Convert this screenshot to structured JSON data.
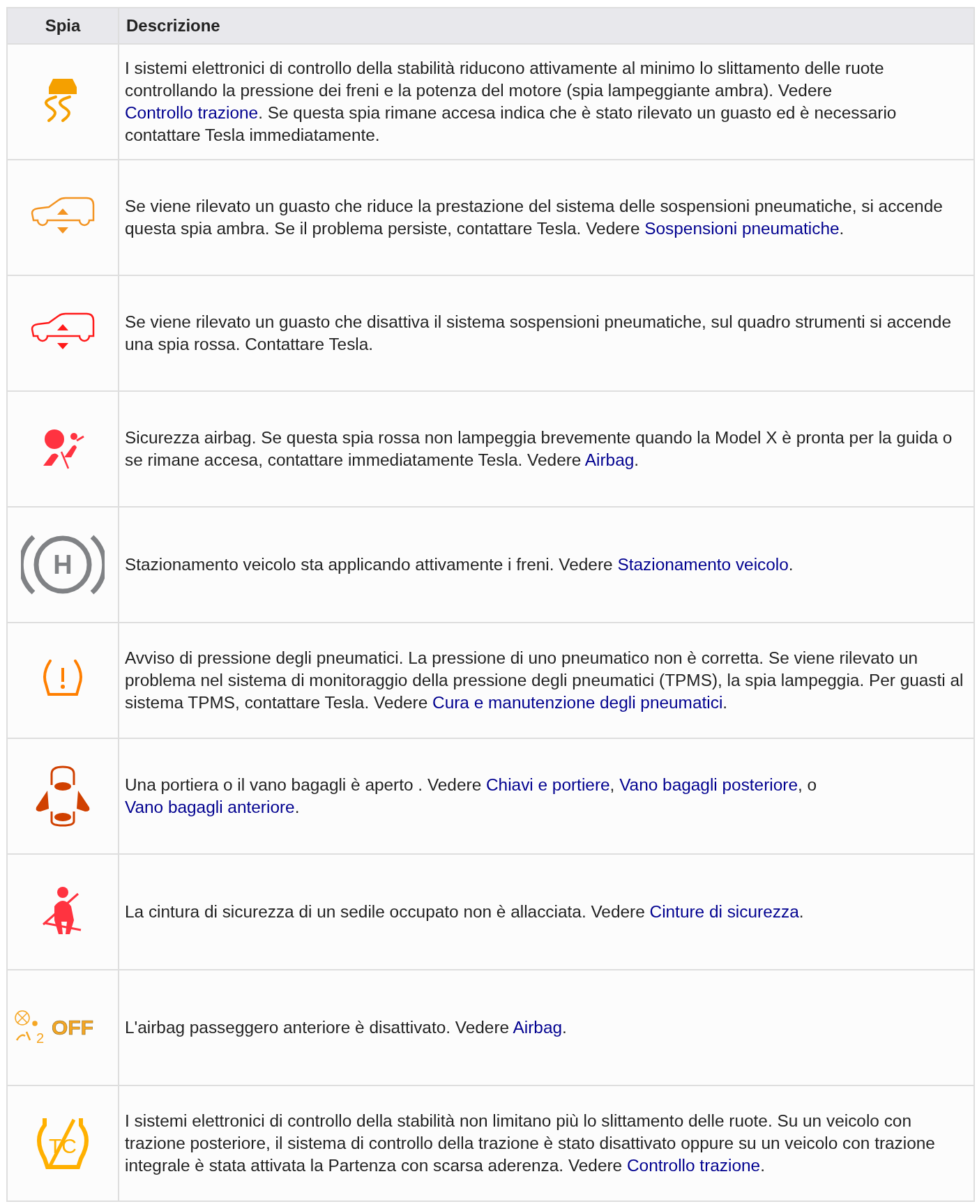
{
  "table": {
    "columns": [
      "Spia",
      "Descrizione"
    ],
    "rows": [
      {
        "description": [
          {
            "text": "I sistemi elettronici di controllo della stabilità riducono attivamente al minimo lo slittamento delle ruote controllando la pressione dei freni e la potenza del motore (spia lampeggiante ambra). Vedere "
          },
          {
            "text": "Controllo trazione",
            "link": true
          },
          {
            "text": ". Se questa spia rimane accesa indica che è stato rilevato un guasto ed è necessario contattare Tesla immediatamente."
          }
        ]
      },
      {
        "description": [
          {
            "text": "Se viene rilevato un guasto che riduce la prestazione del sistema delle sospensioni pneumatiche, si accende questa spia ambra. Se il problema persiste, contattare Tesla. Vedere "
          },
          {
            "text": "Sospensioni pneumatiche",
            "link": true
          },
          {
            "text": "."
          }
        ]
      },
      {
        "description": [
          {
            "text": "Se viene rilevato un guasto che disattiva il sistema sospensioni pneumatiche, sul quadro strumenti si accende una spia rossa. Contattare Tesla."
          }
        ]
      },
      {
        "description": [
          {
            "text": "Sicurezza airbag. Se questa spia rossa non lampeggia brevemente quando la Model X è pronta per la guida o se rimane accesa, contattare immediatamente Tesla. Vedere "
          },
          {
            "text": "Airbag",
            "link": true
          },
          {
            "text": "."
          }
        ]
      },
      {
        "icon_text": [
          "H"
        ],
        "description": [
          {
            "text": "Stazionamento veicolo sta applicando attivamente i freni. Vedere "
          },
          {
            "text": "Stazionamento veicolo",
            "link": true
          },
          {
            "text": "."
          }
        ]
      },
      {
        "description": [
          {
            "text": "Avviso di pressione degli pneumatici. La pressione di uno pneumatico non è corretta. Se viene rilevato un problema nel sistema di monitoraggio della pressione degli pneumatici (TPMS), la spia lampeggia. Per guasti al sistema TPMS, contattare Tesla. Vedere "
          },
          {
            "text": "Cura e manutenzione degli pneumatici",
            "link": true
          },
          {
            "text": "."
          }
        ]
      },
      {
        "description": [
          {
            "text": "Una portiera o il vano bagagli è aperto . Vedere "
          },
          {
            "text": "Chiavi e portiere",
            "link": true
          },
          {
            "text": ", "
          },
          {
            "text": "Vano bagagli posteriore",
            "link": true
          },
          {
            "text": ", o "
          },
          {
            "text": "Vano bagagli anteriore",
            "link": true
          },
          {
            "text": "."
          }
        ]
      },
      {
        "description": [
          {
            "text": "La cintura di sicurezza di un sedile occupato non è allacciata. Vedere "
          },
          {
            "text": "Cinture di sicurezza",
            "link": true
          },
          {
            "text": "."
          }
        ]
      },
      {
        "icon_text": [
          "2",
          "OFF"
        ],
        "description": [
          {
            "text": "L'airbag passeggero anteriore è disattivato. Vedere "
          },
          {
            "text": "Airbag",
            "link": true
          },
          {
            "text": "."
          }
        ]
      },
      {
        "icon_text": [
          "TC"
        ],
        "description": [
          {
            "text": "I sistemi elettronici di controllo della stabilità non limitano più lo slittamento delle ruote. Su un veicolo con trazione posteriore, il sistema di controllo della trazione è stato disattivato oppure su un veicolo con trazione integrale è stata attivata la Partenza con scarsa aderenza. Vedere "
          },
          {
            "text": "Controllo trazione",
            "link": true
          },
          {
            "text": "."
          }
        ]
      }
    ]
  }
}
